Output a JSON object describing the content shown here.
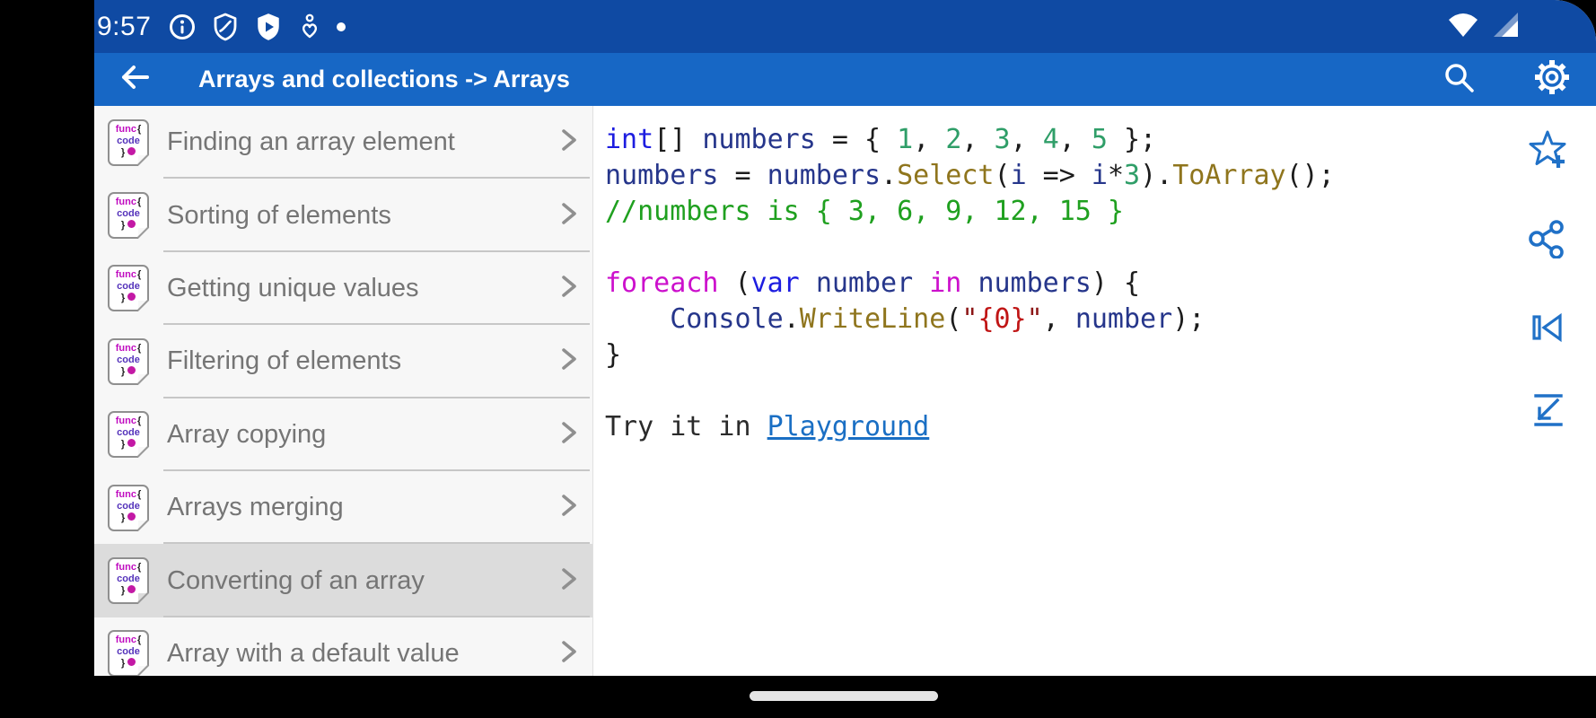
{
  "status_bar": {
    "time": "9:57",
    "left_icons": [
      "info-icon",
      "shield-vpn-icon",
      "play-protect-icon",
      "wellbeing-heart-icon",
      "notification-dot"
    ],
    "right_icons": [
      "wifi-icon",
      "cellular-signal-icon"
    ]
  },
  "app_bar": {
    "title": "Arrays and collections -> Arrays",
    "back_icon": "back-arrow-icon",
    "search_icon": "search-icon",
    "settings_icon": "gear-icon"
  },
  "sidebar": {
    "items": [
      {
        "label": "Finding an array element",
        "selected": false
      },
      {
        "label": "Sorting of elements",
        "selected": false
      },
      {
        "label": "Getting unique values",
        "selected": false
      },
      {
        "label": "Filtering of elements",
        "selected": false
      },
      {
        "label": "Array copying",
        "selected": false
      },
      {
        "label": "Arrays merging",
        "selected": false
      },
      {
        "label": "Converting of an array",
        "selected": true
      },
      {
        "label": "Array with a default value",
        "selected": false
      }
    ]
  },
  "doc_icon": {
    "line1_a": "func",
    "line1_b": "{",
    "line2": "code",
    "line3": "}"
  },
  "code": {
    "lines": [
      [
        [
          "k",
          "int"
        ],
        [
          "p",
          "[] "
        ],
        [
          "i",
          "numbers"
        ],
        [
          "p",
          " = { "
        ],
        [
          "n",
          "1"
        ],
        [
          "p",
          ", "
        ],
        [
          "n",
          "2"
        ],
        [
          "p",
          ", "
        ],
        [
          "n",
          "3"
        ],
        [
          "p",
          ", "
        ],
        [
          "n",
          "4"
        ],
        [
          "p",
          ", "
        ],
        [
          "n",
          "5"
        ],
        [
          "p",
          " };"
        ]
      ],
      [
        [
          "i",
          "numbers"
        ],
        [
          "p",
          " = "
        ],
        [
          "i",
          "numbers"
        ],
        [
          "p",
          "."
        ],
        [
          "m",
          "Select"
        ],
        [
          "p",
          "("
        ],
        [
          "i",
          "i"
        ],
        [
          "p",
          " => "
        ],
        [
          "i",
          "i"
        ],
        [
          "p",
          "*"
        ],
        [
          "n",
          "3"
        ],
        [
          "p",
          ")."
        ],
        [
          "m",
          "ToArray"
        ],
        [
          "p",
          "();"
        ]
      ],
      [
        [
          "c",
          "//numbers is { 3, 6, 9, 12, 15 }"
        ]
      ],
      [],
      [
        [
          "g",
          "foreach"
        ],
        [
          "p",
          " ("
        ],
        [
          "k",
          "var"
        ],
        [
          "p",
          " "
        ],
        [
          "i",
          "number"
        ],
        [
          "p",
          " "
        ],
        [
          "g",
          "in"
        ],
        [
          "p",
          " "
        ],
        [
          "i",
          "numbers"
        ],
        [
          "p",
          ") {"
        ]
      ],
      [
        [
          "p",
          "    "
        ],
        [
          "i",
          "Console"
        ],
        [
          "p",
          "."
        ],
        [
          "m",
          "WriteLine"
        ],
        [
          "p",
          "("
        ],
        [
          "q",
          "\""
        ],
        [
          "s",
          "{0}"
        ],
        [
          "q",
          "\""
        ],
        [
          "p",
          ", "
        ],
        [
          "i",
          "number"
        ],
        [
          "p",
          ");"
        ]
      ],
      [
        [
          "p",
          "}"
        ]
      ],
      [],
      [
        [
          "t",
          "Try it in "
        ],
        [
          "a",
          "Playground"
        ]
      ]
    ]
  },
  "actions": [
    "favorite-add-star-icon",
    "share-icon",
    "skip-to-start-icon",
    "collapse-arrow-icon"
  ],
  "navigation": {
    "home_indicator_icon": "home-indicator-pill"
  },
  "colors": {
    "status_bar": "#0f4aa3",
    "app_bar": "#1767c5",
    "accent_blue": "#2071c7",
    "selected_row": "#dcdcdc",
    "sidebar_bg": "#f7f7f7",
    "link": "#1a6fc4"
  }
}
